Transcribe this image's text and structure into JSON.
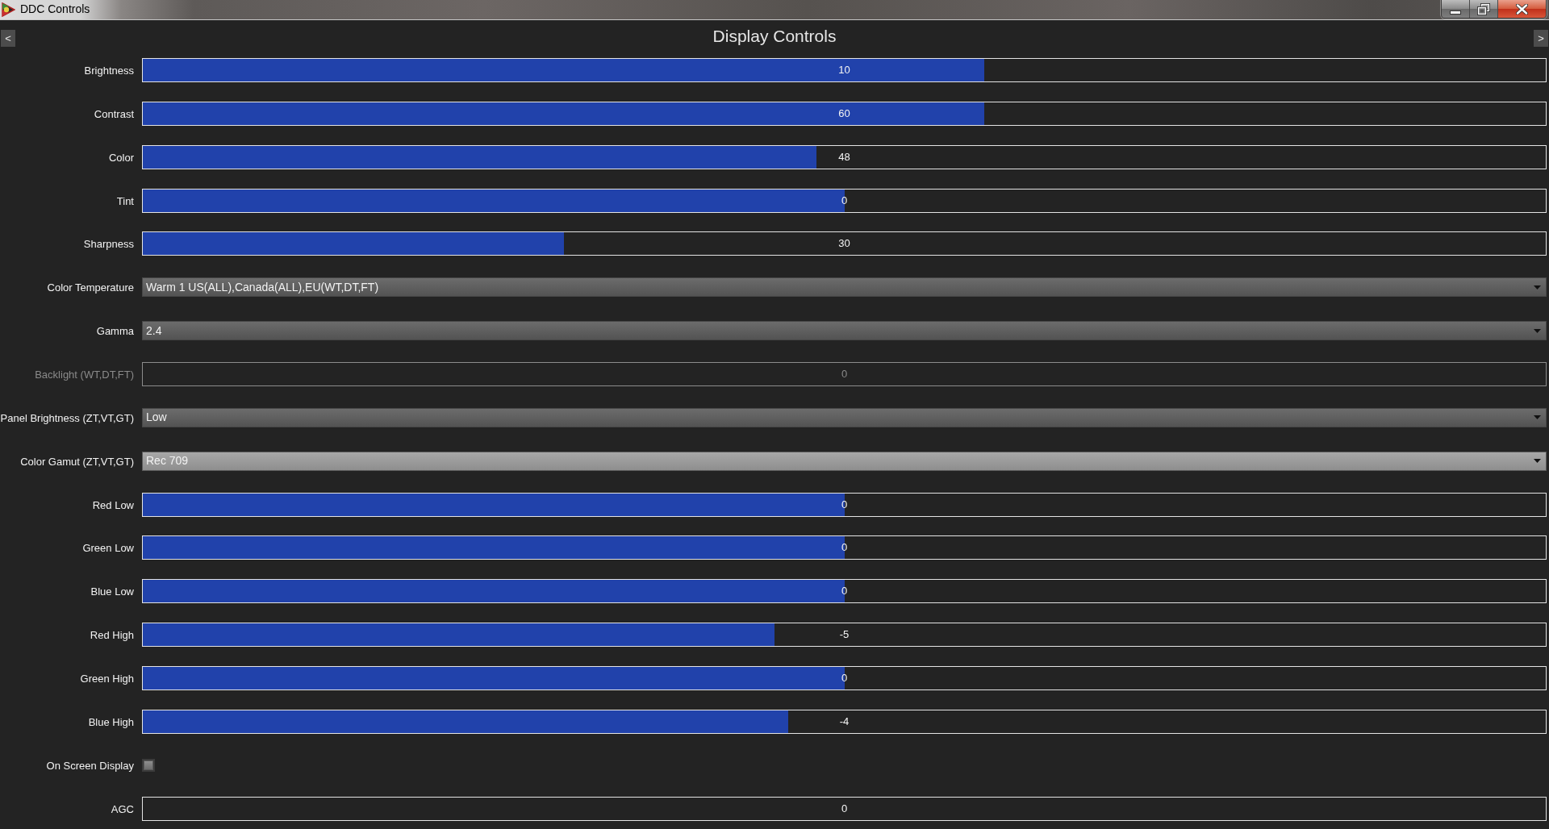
{
  "window": {
    "title": "DDC Controls"
  },
  "header": {
    "prev_button": "<",
    "title": "Display Controls",
    "next_button": ">"
  },
  "controls": [
    {
      "kind": "slider",
      "label": "Brightness",
      "value": "10",
      "level": 0.6,
      "disabled": false
    },
    {
      "kind": "slider",
      "label": "Contrast",
      "value": "60",
      "level": 0.6,
      "disabled": false
    },
    {
      "kind": "slider",
      "label": "Color",
      "value": "48",
      "level": 0.48,
      "disabled": false
    },
    {
      "kind": "slider",
      "label": "Tint",
      "value": "0",
      "level": 0.5,
      "disabled": false
    },
    {
      "kind": "slider",
      "label": "Sharpness",
      "value": "30",
      "level": 0.3,
      "disabled": false
    },
    {
      "kind": "dropdown",
      "label": "Color Temperature",
      "value": "Warm 1 US(ALL),Canada(ALL),EU(WT,DT,FT)",
      "highlighted": false,
      "disabled": false
    },
    {
      "kind": "dropdown",
      "label": "Gamma",
      "value": "2.4",
      "highlighted": false,
      "disabled": false
    },
    {
      "kind": "slider",
      "label": "Backlight (WT,DT,FT)",
      "value": "0",
      "level": 0,
      "disabled": true
    },
    {
      "kind": "dropdown",
      "label": "Panel Brightness (ZT,VT,GT)",
      "value": "Low",
      "highlighted": false,
      "disabled": false
    },
    {
      "kind": "dropdown",
      "label": "Color Gamut (ZT,VT,GT)",
      "value": "Rec 709",
      "highlighted": true,
      "disabled": false
    },
    {
      "kind": "slider",
      "label": "Red Low",
      "value": "0",
      "level": 0.5,
      "disabled": false
    },
    {
      "kind": "slider",
      "label": "Green Low",
      "value": "0",
      "level": 0.5,
      "disabled": false
    },
    {
      "kind": "slider",
      "label": "Blue Low",
      "value": "0",
      "level": 0.5,
      "disabled": false
    },
    {
      "kind": "slider",
      "label": "Red High",
      "value": "-5",
      "level": 0.45,
      "disabled": false
    },
    {
      "kind": "slider",
      "label": "Green High",
      "value": "0",
      "level": 0.5,
      "disabled": false
    },
    {
      "kind": "slider",
      "label": "Blue High",
      "value": "-4",
      "level": 0.46,
      "disabled": false
    },
    {
      "kind": "checkbox",
      "label": "On Screen Display",
      "checked": false,
      "disabled": false
    },
    {
      "kind": "slider",
      "label": "AGC",
      "value": "0",
      "level": 0,
      "disabled": false
    }
  ]
}
